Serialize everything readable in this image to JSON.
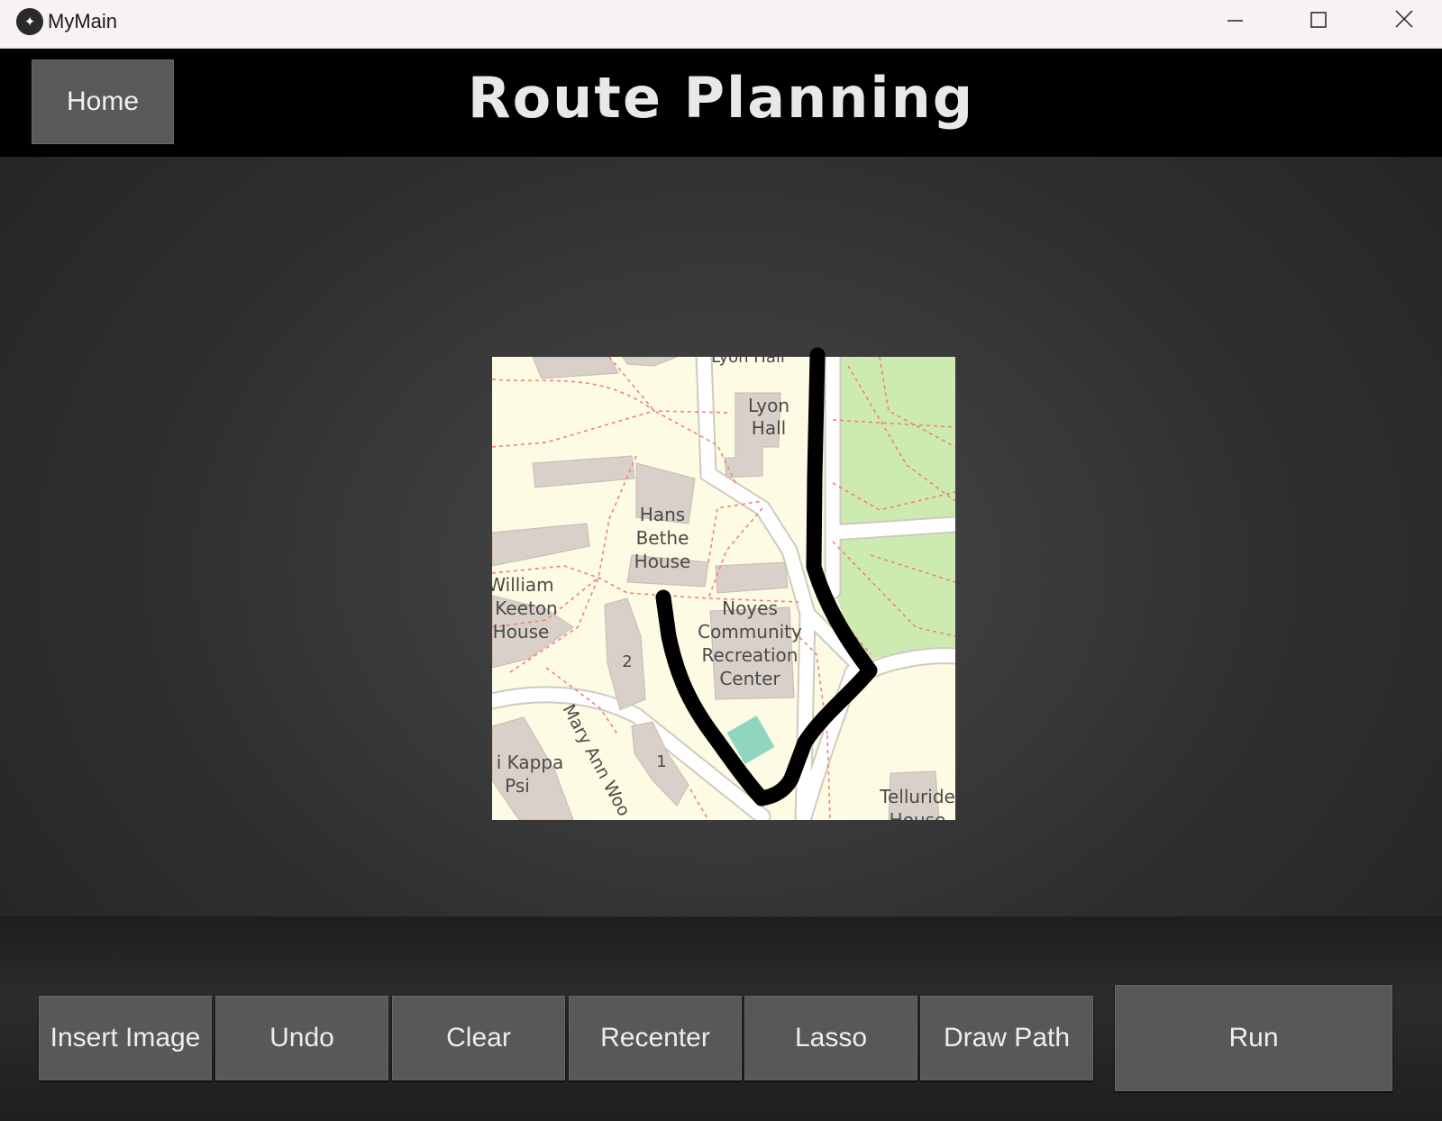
{
  "window": {
    "title": "MyMain",
    "app_icon": "kivy-logo-icon",
    "controls": [
      "minimize-icon",
      "maximize-icon",
      "close-icon"
    ]
  },
  "header": {
    "home_label": "Home",
    "title": "Route Planning"
  },
  "map": {
    "labels": {
      "lyon_hall_top": "Lyon Hall",
      "lyon_hall": "Lyon\nHall",
      "hans_bethe": "Hans\nBethe\nHouse",
      "william_keeton": "William\nKeeton\nHouse",
      "noyes": "Noyes\nCommunity\nRecreation\nCenter",
      "kappa_psi": "i Kappa\nPsi",
      "mary_ann": "Mary Ann Woo",
      "telluride": "Telluride\nHouse",
      "bldg_2": "2",
      "bldg_1": "1"
    },
    "colors": {
      "land": "#fdfbe3",
      "building": "#d9d0c9",
      "park": "#cdebb0",
      "road": "#ffffff",
      "footway": "#f0807c",
      "pitch": "#8fd5c0",
      "route": "#000000"
    }
  },
  "toolbar": {
    "insert_image": "Insert Image",
    "undo": "Undo",
    "clear": "Clear",
    "recenter": "Recenter",
    "lasso": "Lasso",
    "draw_path": "Draw Path",
    "run": "Run"
  }
}
